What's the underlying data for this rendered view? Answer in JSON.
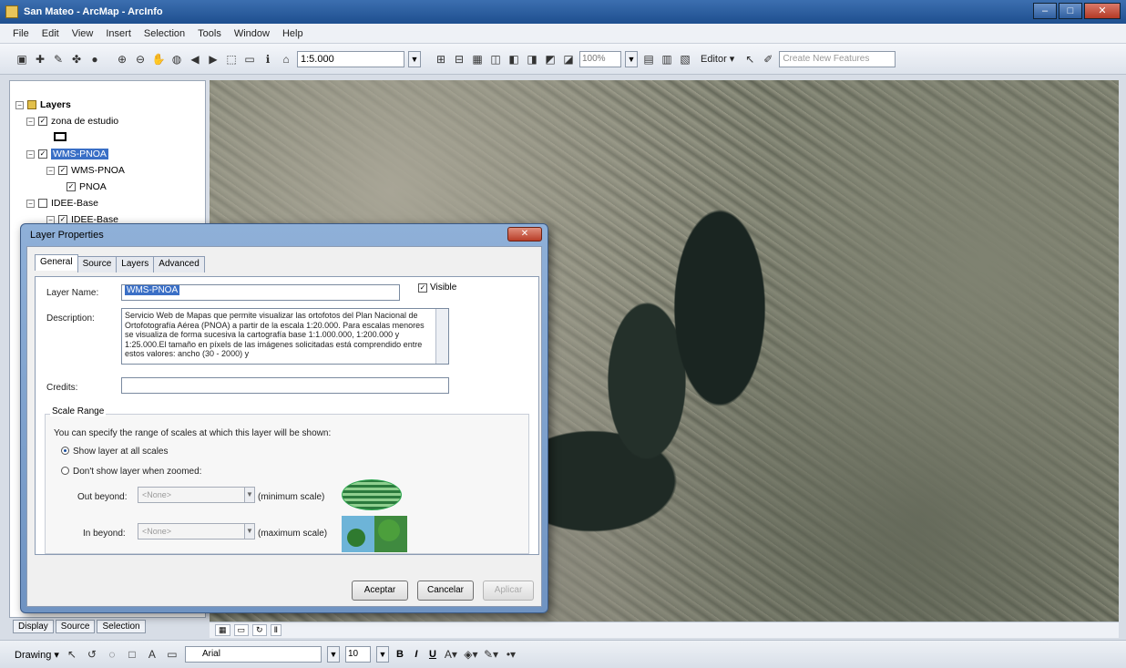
{
  "window": {
    "title": "San Mateo - ArcMap - ArcInfo",
    "buttons": {
      "minimize": "–",
      "maximize": "□",
      "close": "✕"
    }
  },
  "menu": [
    "File",
    "Edit",
    "View",
    "Insert",
    "Selection",
    "Tools",
    "Window",
    "Help"
  ],
  "toolbar": {
    "scale_value": "1:5.000",
    "zoom_value": "100%",
    "editor_label": "Editor ▾",
    "create_features_label": "Create New Features"
  },
  "toc": {
    "items": [
      {
        "label": "Layers",
        "checked": true
      },
      {
        "label": "zona de estudio",
        "checked": true
      },
      {
        "label": "WMS-PNOA",
        "checked": true,
        "selected": true
      },
      {
        "label": "WMS-PNOA",
        "checked": true
      },
      {
        "label": "PNOA",
        "checked": true
      },
      {
        "label": "IDEE-Base",
        "checked": false
      },
      {
        "label": "IDEE-Base",
        "checked": true
      }
    ],
    "tabs": [
      "Display",
      "Source",
      "Selection"
    ]
  },
  "dialog": {
    "title": "Layer Properties",
    "close_label": "✕",
    "tabs": [
      "General",
      "Source",
      "Layers",
      "Advanced"
    ],
    "layer_name_label": "Layer Name:",
    "layer_name_value": "WMS-PNOA",
    "visible_label": "Visible",
    "description_label": "Description:",
    "description_value": "Servicio Web de Mapas que permite visualizar las ortofotos del Plan Nacional de Ortofotografía Aérea (PNOA) a partir de la escala 1:20.000. Para escalas menores se visualiza de forma sucesiva la cartografía base 1:1.000.000, 1:200.000 y 1:25.000.El tamaño en píxels de las imágenes solicitadas está comprendido entre estos valores: ancho (30 - 2000) y",
    "credits_label": "Credits:",
    "credits_value": "",
    "scale_range_title": "Scale Range",
    "scale_range_desc": "You can specify the range of scales at which this layer will be shown:",
    "radio_all": "Show layer at all scales",
    "radio_zoomed": "Don't show layer when zoomed:",
    "out_beyond_label": "Out beyond:",
    "out_beyond_value": "<None>",
    "out_beyond_hint": "(minimum scale)",
    "in_beyond_label": "In beyond:",
    "in_beyond_value": "<None>",
    "in_beyond_hint": "(maximum scale)",
    "buttons": {
      "ok": "Aceptar",
      "cancel": "Cancelar",
      "apply": "Aplicar"
    }
  },
  "drawing_bar": {
    "drawing_label": "Drawing ▾",
    "font_value": "Arial",
    "size_value": "10",
    "bold": "B",
    "italic": "I",
    "underline": "U"
  }
}
